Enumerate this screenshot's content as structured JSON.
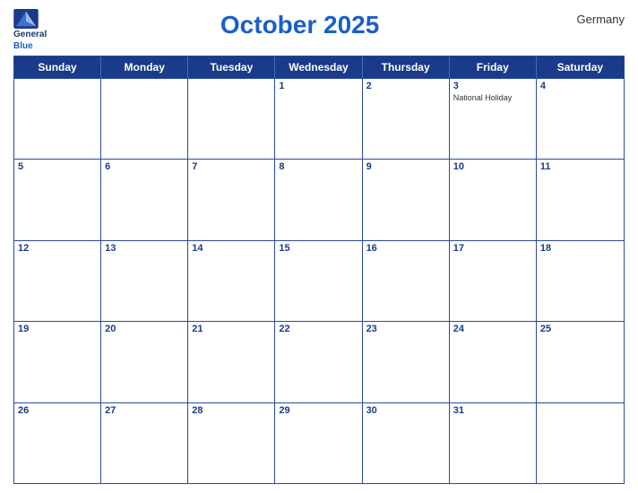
{
  "logo": {
    "line1": "General",
    "line2": "Blue"
  },
  "title": "October 2025",
  "country": "Germany",
  "days_of_week": [
    "Sunday",
    "Monday",
    "Tuesday",
    "Wednesday",
    "Thursday",
    "Friday",
    "Saturday"
  ],
  "weeks": [
    [
      {
        "date": "",
        "holiday": ""
      },
      {
        "date": "",
        "holiday": ""
      },
      {
        "date": "",
        "holiday": ""
      },
      {
        "date": "1",
        "holiday": ""
      },
      {
        "date": "2",
        "holiday": ""
      },
      {
        "date": "3",
        "holiday": "National Holiday"
      },
      {
        "date": "4",
        "holiday": ""
      }
    ],
    [
      {
        "date": "5",
        "holiday": ""
      },
      {
        "date": "6",
        "holiday": ""
      },
      {
        "date": "7",
        "holiday": ""
      },
      {
        "date": "8",
        "holiday": ""
      },
      {
        "date": "9",
        "holiday": ""
      },
      {
        "date": "10",
        "holiday": ""
      },
      {
        "date": "11",
        "holiday": ""
      }
    ],
    [
      {
        "date": "12",
        "holiday": ""
      },
      {
        "date": "13",
        "holiday": ""
      },
      {
        "date": "14",
        "holiday": ""
      },
      {
        "date": "15",
        "holiday": ""
      },
      {
        "date": "16",
        "holiday": ""
      },
      {
        "date": "17",
        "holiday": ""
      },
      {
        "date": "18",
        "holiday": ""
      }
    ],
    [
      {
        "date": "19",
        "holiday": ""
      },
      {
        "date": "20",
        "holiday": ""
      },
      {
        "date": "21",
        "holiday": ""
      },
      {
        "date": "22",
        "holiday": ""
      },
      {
        "date": "23",
        "holiday": ""
      },
      {
        "date": "24",
        "holiday": ""
      },
      {
        "date": "25",
        "holiday": ""
      }
    ],
    [
      {
        "date": "26",
        "holiday": ""
      },
      {
        "date": "27",
        "holiday": ""
      },
      {
        "date": "28",
        "holiday": ""
      },
      {
        "date": "29",
        "holiday": ""
      },
      {
        "date": "30",
        "holiday": ""
      },
      {
        "date": "31",
        "holiday": ""
      },
      {
        "date": "",
        "holiday": ""
      }
    ]
  ]
}
